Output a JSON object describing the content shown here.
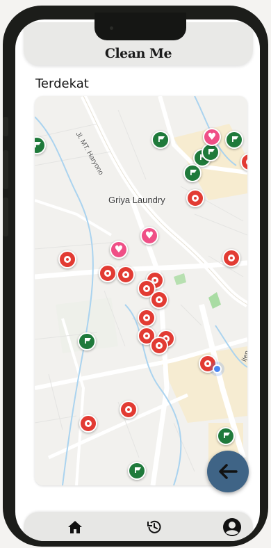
{
  "app": {
    "title": "Clean Me"
  },
  "section": {
    "title": "Terdekat"
  },
  "map": {
    "place_label": "Griya Laundry",
    "road_labels": [
      "Jl. MT. Haryono",
      "Ijen St"
    ],
    "marker_colors": {
      "laundry": "#e23b33",
      "favorite": "#ef4f86",
      "dropoff": "#1f7a3b"
    }
  },
  "fab": {
    "icon": "arrow-left-icon",
    "color": "#3f6486"
  },
  "bottom_nav": {
    "items": [
      {
        "name": "home",
        "icon": "home-icon"
      },
      {
        "name": "history",
        "icon": "history-icon"
      },
      {
        "name": "profile",
        "icon": "profile-icon"
      }
    ]
  }
}
